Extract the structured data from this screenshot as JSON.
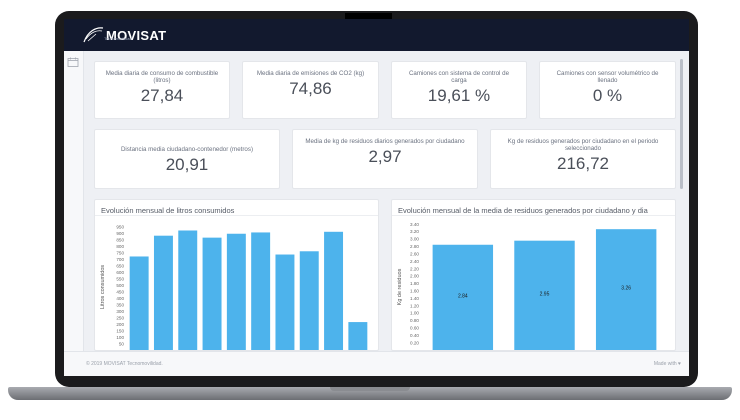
{
  "brand": {
    "name": "MOVISAT",
    "tagline": "Tecnomovilidad"
  },
  "kpis_row1": [
    {
      "label": "Media diaria de consumo de combustible (litros)",
      "value": "27,84"
    },
    {
      "label": "Media diaria de emisiones de CO2 (kg)",
      "value": "74,86"
    },
    {
      "label": "Camiones con sistema de control de carga",
      "value": "19,61 %"
    },
    {
      "label": "Camiones con sensor volumétrico de llenado",
      "value": "0 %"
    }
  ],
  "kpis_row2": [
    {
      "label": "Distancia media ciudadano-contenedor (metros)",
      "value": "20,91"
    },
    {
      "label": "Media de kg de residuos diarios generados por ciudadano",
      "value": "2,97"
    },
    {
      "label": "Kg de residuos generados por ciudadano en el periodo seleccionado",
      "value": "216,72"
    }
  ],
  "footer": {
    "copyright": "© 2019 MOVISAT Tecnomovilidad.",
    "made_with": "Made with ♥"
  },
  "colors": {
    "bar": "#4db3ec",
    "topbar": "#12192e"
  },
  "chart_data": [
    {
      "type": "bar",
      "title": "Evolución mensual de litros consumidos",
      "ylabel": "Litros consumidos",
      "xlabel": "",
      "yticks": [
        "950",
        "900",
        "850",
        "800",
        "750",
        "700",
        "650",
        "600",
        "550",
        "500",
        "450",
        "400",
        "350",
        "300",
        "250",
        "200",
        "150",
        "100",
        "50"
      ],
      "ylim": [
        0,
        970
      ],
      "values": [
        720,
        880,
        920,
        865,
        895,
        905,
        735,
        760,
        910,
        215
      ]
    },
    {
      "type": "bar",
      "title": "Evolución mensual de la media de residuos generados por ciudadano y dia",
      "ylabel": "Kg de residuos",
      "xlabel": "",
      "yticks": [
        "3.40",
        "3.20",
        "3.00",
        "2.80",
        "2.60",
        "2.40",
        "2.20",
        "2.00",
        "1.80",
        "1.60",
        "1.40",
        "1.20",
        "1.00",
        "0.80",
        "0.60",
        "0.40",
        "0.20"
      ],
      "ylim": [
        0,
        3.4
      ],
      "values": [
        2.84,
        2.95,
        3.26
      ],
      "data_labels": [
        "2.84",
        "2.95",
        "3.26"
      ]
    }
  ]
}
